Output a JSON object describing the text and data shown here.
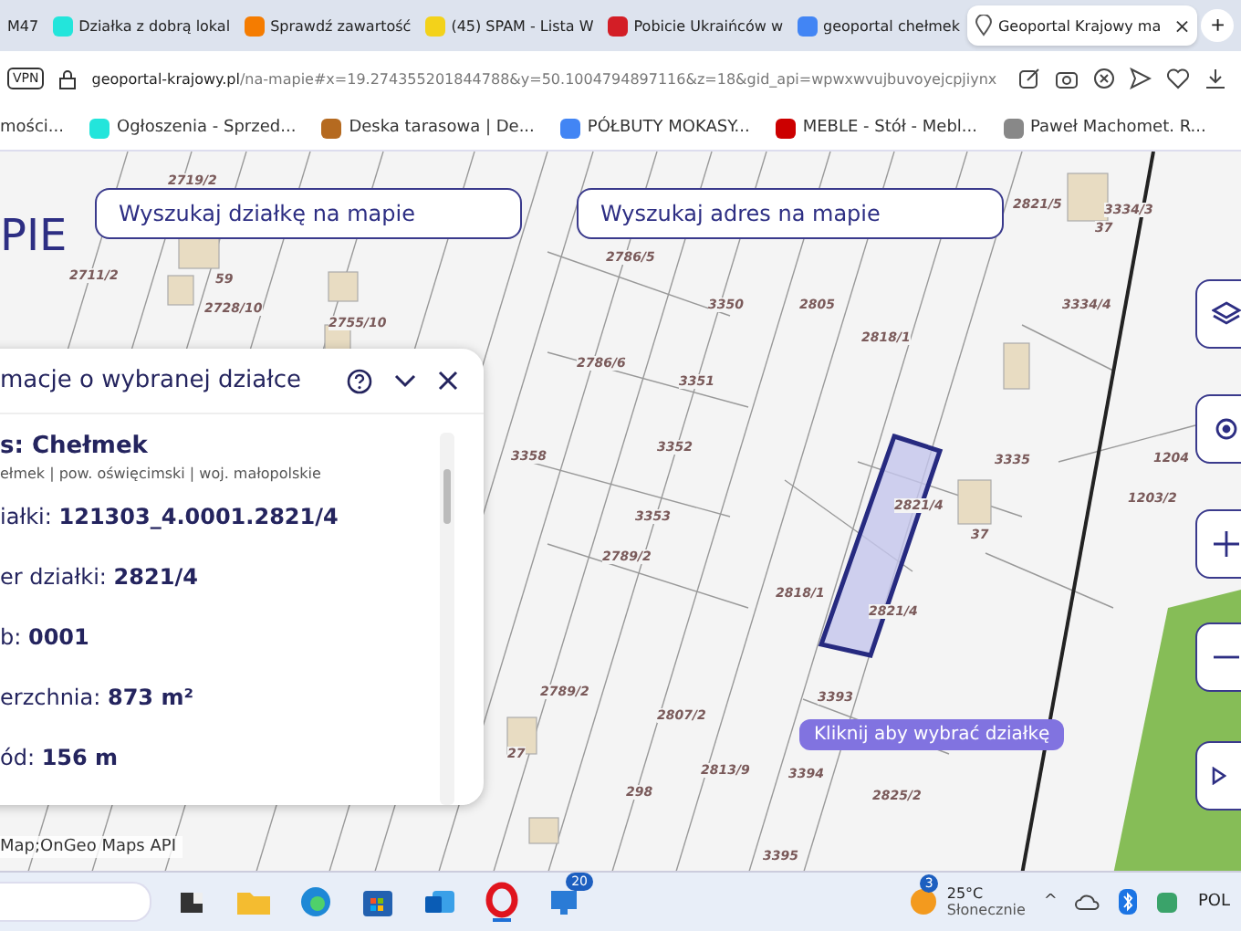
{
  "tabs": [
    {
      "title": "M47",
      "kind": "none",
      "selected": false
    },
    {
      "title": "Działka z dobrą lokal",
      "kind": "olx",
      "selected": false
    },
    {
      "title": "Sprawdź zawartość",
      "kind": "a",
      "selected": false
    },
    {
      "title": "(45) SPAM - Lista W",
      "kind": "mail",
      "selected": false
    },
    {
      "title": "Pobicie Ukraińców w",
      "kind": "f",
      "selected": false
    },
    {
      "title": "geoportal chełmek",
      "kind": "g",
      "selected": false
    },
    {
      "title": "Geoportal Krajowy ma",
      "kind": "pin",
      "selected": true
    }
  ],
  "tab_close": "×",
  "new_tab": "+",
  "address_bar": {
    "vpn": "VPN",
    "host": "geoportal-krajowy.pl",
    "path": "/na-mapie#x=19.274355201844788&y=50.1004794897116&z=18&gid_api=wpwxwvujbuvoyejcpjiynx"
  },
  "bookmarks": [
    {
      "title": "mości...",
      "kind": "none"
    },
    {
      "title": "Ogłoszenia - Sprzed...",
      "kind": "olx"
    },
    {
      "title": "Deska tarasowa | De...",
      "kind": "wood"
    },
    {
      "title": "PÓŁBUTY MOKASY...",
      "kind": "g"
    },
    {
      "title": "MEBLE - Stół - Mebl...",
      "kind": "meble"
    },
    {
      "title": "Paweł Machomet. R...",
      "kind": "p"
    }
  ],
  "map": {
    "logo_text": "PIE",
    "search_parcel": {
      "placeholder": "Wyszukaj działkę na mapie"
    },
    "search_address": {
      "placeholder": "Wyszukaj adres na mapie"
    },
    "parcel_labels": [
      "2719/2",
      "2711/2",
      "59",
      "2728/10",
      "2755/10",
      "2786/5",
      "3350",
      "2805",
      "2818/1",
      "2786/6",
      "3351",
      "3358",
      "3352",
      "3353",
      "2821/5",
      "3334/3",
      "37",
      "3334/4",
      "3335",
      "1204",
      "2821/4",
      "37",
      "2789/2",
      "2818/1",
      "2821/4",
      "1203/2",
      "2789/2",
      "2807/2",
      "3393",
      "27",
      "2813/9",
      "3394",
      "298",
      "2825/2",
      "3395"
    ],
    "info_panel": {
      "title": "macje o wybranej działce",
      "place": "s: Chełmek",
      "region": "ełmek | pow. oświęcimski | woj. małopolskie",
      "rows": [
        "iałki: **121303_4.0001.2821/4**",
        "er działki: **2821/4**",
        "b: **0001**",
        "erzchnia: **873 m²**",
        "ód: **156 m**"
      ]
    },
    "tooltip": "Kliknij aby wybrać działkę",
    "attribution": "Map;OnGeo Maps API"
  },
  "taskbar": {
    "apps": [
      {
        "kind": "widgets"
      },
      {
        "kind": "folder"
      },
      {
        "kind": "edge"
      },
      {
        "kind": "store"
      },
      {
        "kind": "outlook"
      },
      {
        "kind": "opera"
      },
      {
        "kind": "remote",
        "badge": "20"
      }
    ],
    "weather": {
      "badge": "3",
      "temp": "25°C",
      "desc": "Słonecznie"
    },
    "tray_caret": "^",
    "language": "POL"
  }
}
